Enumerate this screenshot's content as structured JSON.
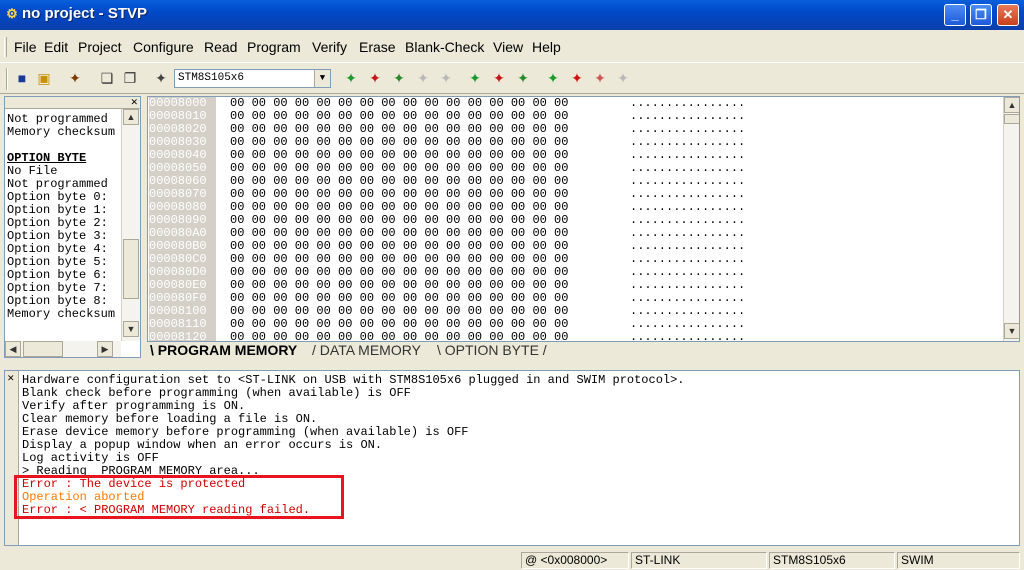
{
  "window": {
    "title": "no project - STVP",
    "icon": "stvp-app-icon"
  },
  "menu": [
    "File",
    "Edit",
    "Project",
    "Configure",
    "Read",
    "Program",
    "Verify",
    "Erase",
    "Blank-Check",
    "View",
    "Help"
  ],
  "toolbar": {
    "device": "STM8S105x6"
  },
  "left_panel": {
    "lines": [
      "Not programmed",
      "Memory checksum",
      "",
      "OPTION BYTE",
      "No File",
      "Not programmed",
      "Option byte 0:",
      "Option byte 1:",
      "Option byte 2:",
      "Option byte 3:",
      "Option byte 4:",
      "Option byte 5:",
      "Option byte 6:",
      "Option byte 7:",
      "Option byte 8:",
      "Memory checksum"
    ]
  },
  "memory": {
    "rows": [
      {
        "addr": "00008000",
        "bytes": "00 00 00 00 00 00 00 00 00 00 00 00 00 00 00 00",
        "ascii": "................"
      },
      {
        "addr": "00008010",
        "bytes": "00 00 00 00 00 00 00 00 00 00 00 00 00 00 00 00",
        "ascii": "................"
      },
      {
        "addr": "00008020",
        "bytes": "00 00 00 00 00 00 00 00 00 00 00 00 00 00 00 00",
        "ascii": "................"
      },
      {
        "addr": "00008030",
        "bytes": "00 00 00 00 00 00 00 00 00 00 00 00 00 00 00 00",
        "ascii": "................"
      },
      {
        "addr": "00008040",
        "bytes": "00 00 00 00 00 00 00 00 00 00 00 00 00 00 00 00",
        "ascii": "................"
      },
      {
        "addr": "00008050",
        "bytes": "00 00 00 00 00 00 00 00 00 00 00 00 00 00 00 00",
        "ascii": "................"
      },
      {
        "addr": "00008060",
        "bytes": "00 00 00 00 00 00 00 00 00 00 00 00 00 00 00 00",
        "ascii": "................"
      },
      {
        "addr": "00008070",
        "bytes": "00 00 00 00 00 00 00 00 00 00 00 00 00 00 00 00",
        "ascii": "................"
      },
      {
        "addr": "00008080",
        "bytes": "00 00 00 00 00 00 00 00 00 00 00 00 00 00 00 00",
        "ascii": "................"
      },
      {
        "addr": "00008090",
        "bytes": "00 00 00 00 00 00 00 00 00 00 00 00 00 00 00 00",
        "ascii": "................"
      },
      {
        "addr": "000080A0",
        "bytes": "00 00 00 00 00 00 00 00 00 00 00 00 00 00 00 00",
        "ascii": "................"
      },
      {
        "addr": "000080B0",
        "bytes": "00 00 00 00 00 00 00 00 00 00 00 00 00 00 00 00",
        "ascii": "................"
      },
      {
        "addr": "000080C0",
        "bytes": "00 00 00 00 00 00 00 00 00 00 00 00 00 00 00 00",
        "ascii": "................"
      },
      {
        "addr": "000080D0",
        "bytes": "00 00 00 00 00 00 00 00 00 00 00 00 00 00 00 00",
        "ascii": "................"
      },
      {
        "addr": "000080E0",
        "bytes": "00 00 00 00 00 00 00 00 00 00 00 00 00 00 00 00",
        "ascii": "................"
      },
      {
        "addr": "000080F0",
        "bytes": "00 00 00 00 00 00 00 00 00 00 00 00 00 00 00 00",
        "ascii": "................"
      },
      {
        "addr": "00008100",
        "bytes": "00 00 00 00 00 00 00 00 00 00 00 00 00 00 00 00",
        "ascii": "................"
      },
      {
        "addr": "00008110",
        "bytes": "00 00 00 00 00 00 00 00 00 00 00 00 00 00 00 00",
        "ascii": "................"
      },
      {
        "addr": "00008120",
        "bytes": "00 00 00 00 00 00 00 00 00 00 00 00 00 00 00 00",
        "ascii": "................"
      }
    ],
    "tabs": [
      "PROGRAM MEMORY",
      "DATA MEMORY",
      "OPTION BYTE"
    ],
    "active_tab": "PROGRAM MEMORY"
  },
  "log": {
    "lines": [
      {
        "text": "Hardware configuration set to <ST-LINK on USB with STM8S105x6 plugged in and SWIM protocol>.",
        "color": "#000000"
      },
      {
        "text": "Blank check before programming (when available) is OFF",
        "color": "#000000"
      },
      {
        "text": "Verify after programming is ON.",
        "color": "#000000"
      },
      {
        "text": "Clear memory before loading a file is ON.",
        "color": "#000000"
      },
      {
        "text": "Erase device memory before programming (when available) is OFF",
        "color": "#000000"
      },
      {
        "text": "Display a popup window when an error occurs is ON.",
        "color": "#000000"
      },
      {
        "text": "Log activity is OFF",
        "color": "#000000"
      },
      {
        "text": "> Reading  PROGRAM MEMORY area...",
        "color": "#000000"
      },
      {
        "text": "Error : The device is protected",
        "color": "#d00000"
      },
      {
        "text": "Operation aborted",
        "color": "#ff7a00"
      },
      {
        "text": "Error : < PROGRAM MEMORY reading failed.",
        "color": "#d00000"
      }
    ]
  },
  "status": {
    "address": "@ <0x008000>",
    "link": "ST-LINK",
    "device": "STM8S105x6",
    "protocol": "SWIM"
  },
  "colors": {
    "titlebar": "#0054e3",
    "error": "#d00000",
    "warning": "#ff7a00",
    "highlight_box": "#e8141e"
  }
}
